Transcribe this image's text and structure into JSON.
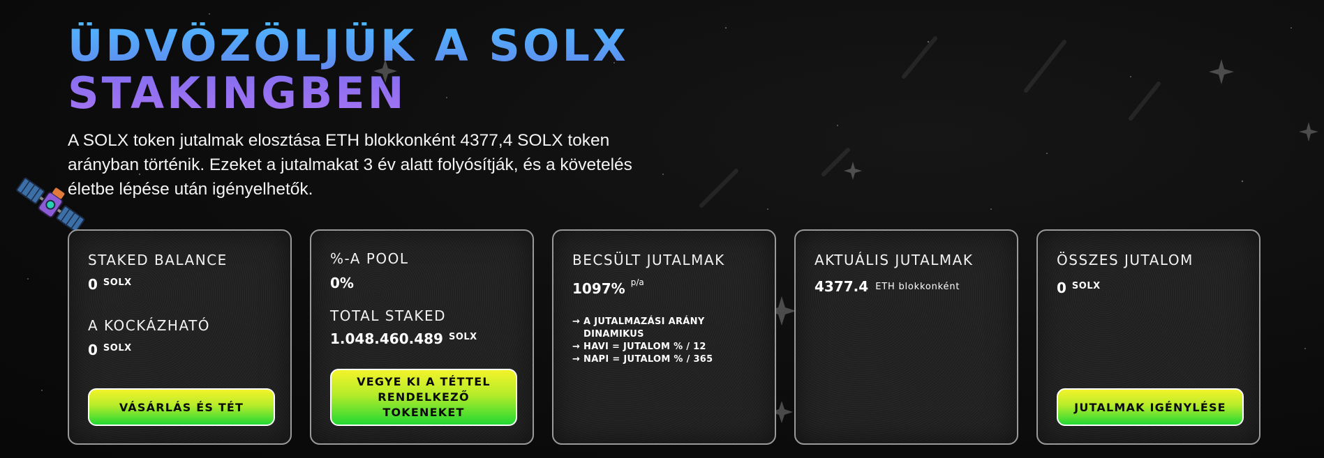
{
  "hero": {
    "title_line1": "ÜDVÖZÖLJÜK A SOLX",
    "title_line2": "STAKINGBEN",
    "intro": "A SOLX token jutalmak elosztása ETH blokkonként 4377,4 SOLX token arányban történik. Ezeket a jutalmakat 3 év alatt folyósítják, és a követelés életbe lépése után igényelhetők."
  },
  "cards": {
    "staked": {
      "label": "STAKED BALANCE",
      "value": "0",
      "unit": "SOLX",
      "label2": "A KOCKÁZHATÓ",
      "value2": "0",
      "unit2": "SOLX",
      "button": "VÁSÁRLÁS ÉS TÉT"
    },
    "pool": {
      "label": "%-A POOL",
      "value": "0%",
      "label2": "TOTAL STAKED",
      "value2": "1.048.460.489",
      "unit2": "SOLX",
      "button": "VEGYE KI A TÉTTEL RENDELKEZŐ TOKENEKET"
    },
    "estimated": {
      "label": "BECSÜLT JUTALMAK",
      "value": "1097%",
      "suffix": "p/a",
      "notes": [
        "→ A JUTALMAZÁSI ARÁNY DINAMIKUS",
        "→ HAVI = JUTALOM % / 12",
        "→ NAPI = JUTALOM % / 365"
      ]
    },
    "current": {
      "label": "AKTUÁLIS JUTALMAK",
      "value": "4377.4",
      "unit": "ETH blokkonként"
    },
    "total": {
      "label": "ÖSSZES JUTALOM",
      "value": "0",
      "unit": "SOLX",
      "button": "JUTALMAK IGÉNYLÉSE"
    }
  },
  "colors": {
    "button_top": "#f3f32a",
    "button_bottom": "#22d833",
    "card_bg": "#202020",
    "card_border": "#9a9a9a",
    "title_blue": "#4fb6ff",
    "title_purple": "#a574f2"
  }
}
